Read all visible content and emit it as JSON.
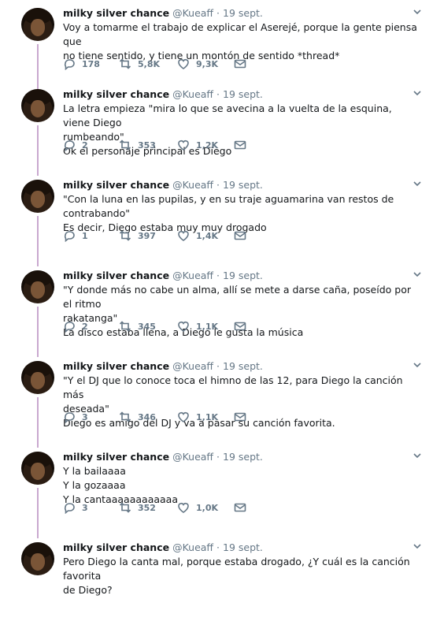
{
  "author": {
    "name": "milky silver chance",
    "handle": "@Kueaff",
    "date": "19 sept."
  },
  "tweets": [
    {
      "lines": [
        "Voy a tomarme el trabajo de explicar el Aserejé, porque la gente piensa que",
        "no tiene sentido, y tiene un montón de sentido *thread*"
      ],
      "replies": "178",
      "retweets": "5,8K",
      "likes": "9,3K"
    },
    {
      "lines": [
        "La letra empieza \"mira lo que se avecina a la vuelta de la esquina, viene Diego",
        "rumbeando\"",
        "Ok el personaje principal es Diego"
      ],
      "replies": "2",
      "retweets": "353",
      "likes": "1,2K"
    },
    {
      "lines": [
        "\"Con la luna en las pupilas, y en su traje aguamarina van restos de",
        "contrabando\"",
        "Es decir, Diego estaba muy muy drogado"
      ],
      "replies": "1",
      "retweets": "397",
      "likes": "1,4K"
    },
    {
      "lines": [
        "\"Y donde más no cabe un alma, allí se mete a darse caña, poseído por el ritmo",
        "rakatanga\"",
        "La disco estaba llena, a Diego le gusta la música"
      ],
      "replies": "2",
      "retweets": "345",
      "likes": "1,1K"
    },
    {
      "lines": [
        "\"Y el DJ que lo conoce toca el himno de las 12, para Diego la canción más",
        "deseada\"",
        "Diego es amigo del DJ y va a pasar su canción favorita."
      ],
      "replies": "3",
      "retweets": "346",
      "likes": "1,1K"
    },
    {
      "lines": [
        "Y la bailaaaa",
        "Y la gozaaaa",
        "Y la cantaaaaaaaaaaaa"
      ],
      "replies": "3",
      "retweets": "352",
      "likes": "1,0K"
    },
    {
      "lines": [
        "Pero Diego la canta mal, porque estaba drogado, ¿Y cuál es la canción favorita",
        "de Diego?"
      ],
      "replies": "",
      "retweets": "",
      "likes": ""
    }
  ],
  "icons": {
    "reply": "reply-icon",
    "retweet": "retweet-icon",
    "like": "heart-icon",
    "dm": "envelope-icon",
    "menu": "chevron-down-icon"
  },
  "colors": {
    "thread_line": "#c9a8cf",
    "secondary_text": "#657786"
  }
}
